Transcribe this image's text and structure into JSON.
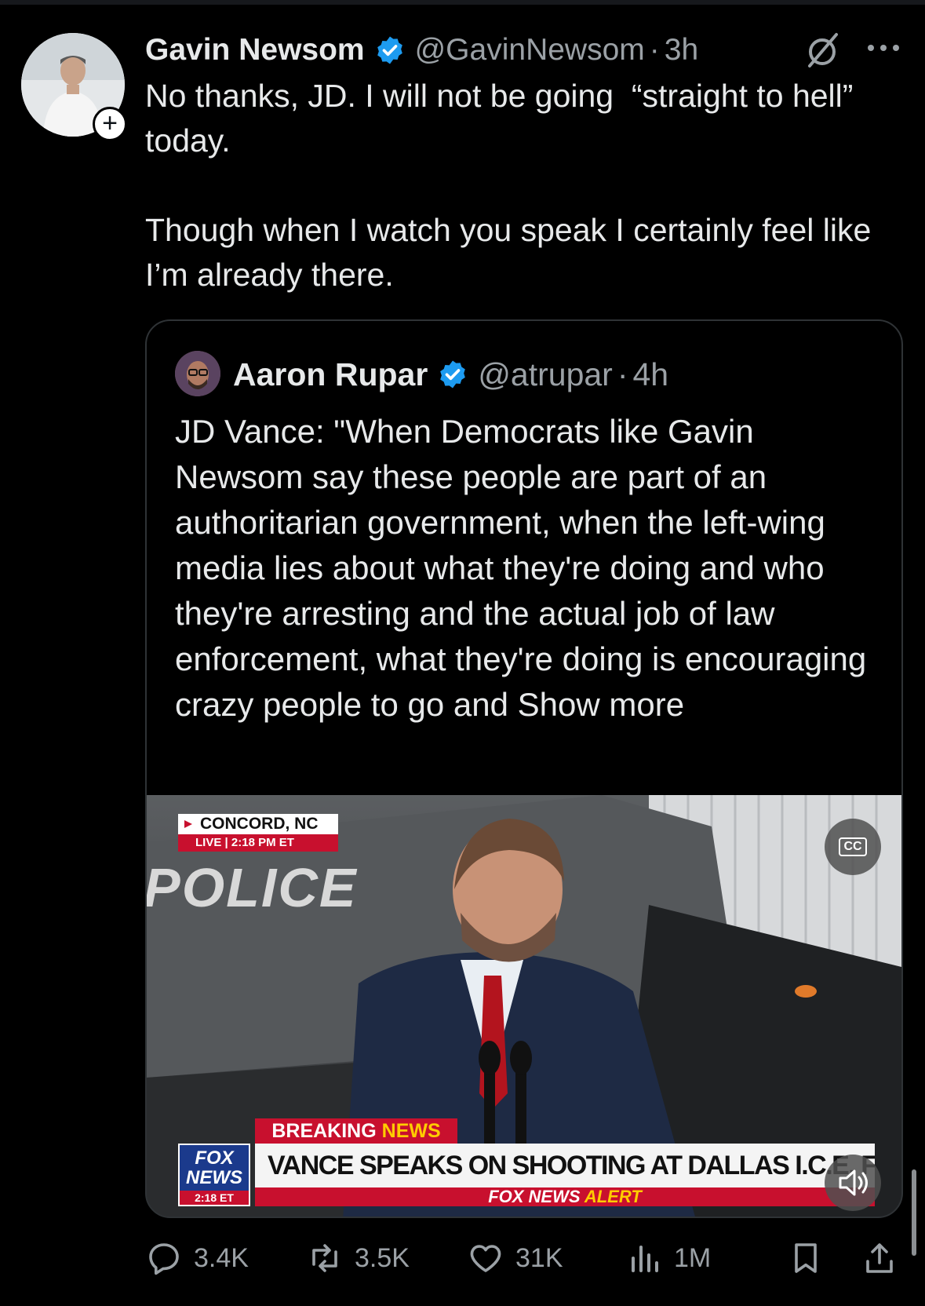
{
  "tweet": {
    "author_name": "Gavin Newsom",
    "handle": "@GavinNewsom",
    "separator": "·",
    "time": "3h",
    "text": "No thanks, JD. I will not be going  “straight to hell” today.\n\nThough when I watch you speak I certainly feel like I’m already there.",
    "follow_symbol": "+",
    "icons": [
      "verified-badge-icon",
      "grok-icon",
      "more-icon"
    ]
  },
  "quote": {
    "author_name": "Aaron Rupar",
    "handle": "@atrupar",
    "separator": "·",
    "time": "4h",
    "text": "JD Vance: \"When Democrats like Gavin Newsom say these people are part of an authoritarian government, when the left-wing media lies about what they're doing and who they're arresting and the actual job of law enforcement, what they're doing is encouraging crazy people to go and ",
    "show_more": "Show more",
    "video": {
      "location": "CONCORD, NC",
      "live_label": "LIVE",
      "live_time": "2:18 PM ET",
      "background_text": "POLICE",
      "breaking_prefix": "BREAKING",
      "breaking_suffix": "NEWS",
      "headline": "VANCE SPEAKS ON SHOOTING AT DALLAS I.C.E. FACILITY",
      "alert_prefix": "FOX NEWS",
      "alert_suffix": "ALERT",
      "logo_line1": "FOX",
      "logo_line2": "NEWS",
      "logo_time": "2:18 ET",
      "cc_label": "CC"
    }
  },
  "actions": {
    "replies": "3.4K",
    "reposts": "3.5K",
    "likes": "31K",
    "views": "1M"
  },
  "colors": {
    "background": "#000000",
    "text_primary": "#e7e9ea",
    "text_secondary": "#9ba1a6",
    "verified_blue": "#1d9bf0",
    "fox_red": "#c8102e",
    "fox_yellow": "#ffcc00"
  }
}
